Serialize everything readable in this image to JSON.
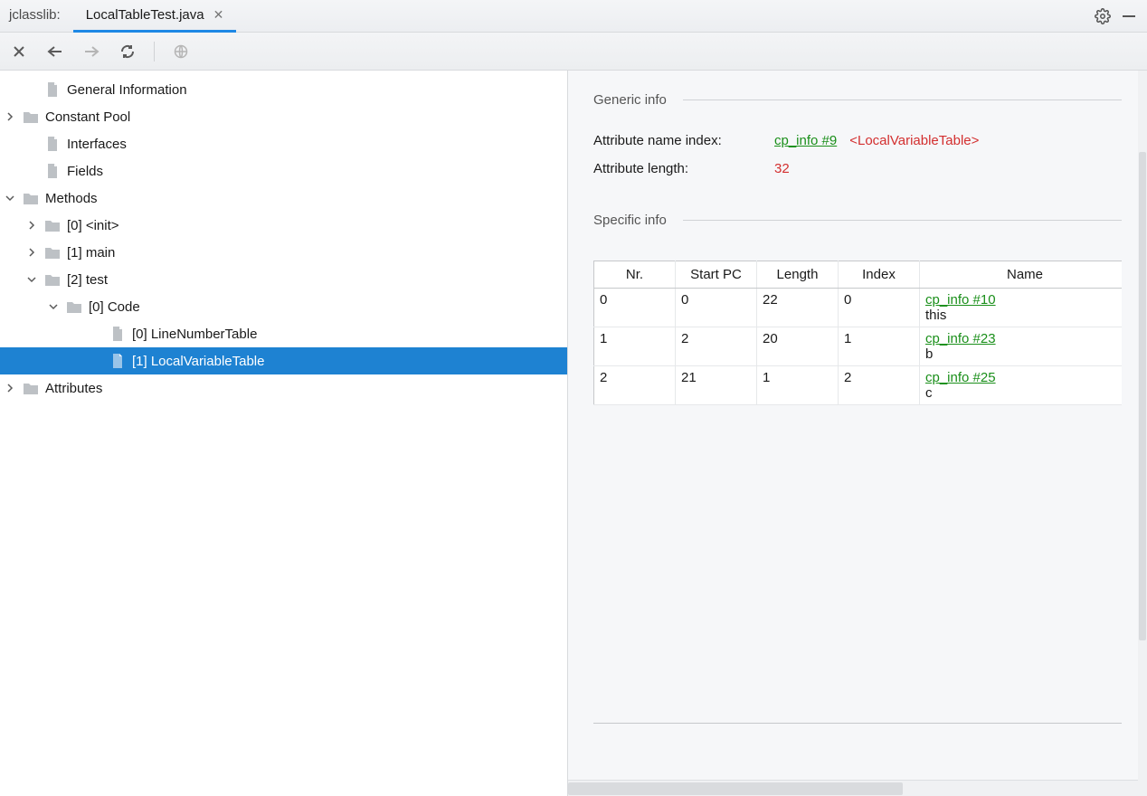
{
  "tabs": {
    "static_label": "jclasslib:",
    "active_label": "LocalTableTest.java"
  },
  "tree": {
    "items": [
      {
        "indent": 1,
        "expander": "",
        "icon": "file",
        "label": "General Information"
      },
      {
        "indent": 0,
        "expander": ">",
        "icon": "folder",
        "label": "Constant Pool"
      },
      {
        "indent": 1,
        "expander": "",
        "icon": "file",
        "label": "Interfaces"
      },
      {
        "indent": 1,
        "expander": "",
        "icon": "file",
        "label": "Fields"
      },
      {
        "indent": 0,
        "expander": "v",
        "icon": "folder",
        "label": "Methods"
      },
      {
        "indent": 1,
        "expander": ">",
        "icon": "folder",
        "label": "[0] <init>"
      },
      {
        "indent": 1,
        "expander": ">",
        "icon": "folder",
        "label": "[1] main"
      },
      {
        "indent": 1,
        "expander": "v",
        "icon": "folder",
        "label": "[2] test"
      },
      {
        "indent": 2,
        "expander": "v",
        "icon": "folder",
        "label": "[0] Code"
      },
      {
        "indent": 4,
        "expander": "",
        "icon": "file",
        "label": "[0] LineNumberTable"
      },
      {
        "indent": 4,
        "expander": "",
        "icon": "file",
        "label": "[1] LocalVariableTable",
        "selected": true
      },
      {
        "indent": 0,
        "expander": ">",
        "icon": "folder",
        "label": "Attributes"
      }
    ]
  },
  "detail": {
    "section1": "Generic info",
    "section2": "Specific info",
    "attr_name_label": "Attribute name index:",
    "attr_name_link": "cp_info #9",
    "attr_name_desc": "<LocalVariableTable>",
    "attr_len_label": "Attribute length:",
    "attr_len_value": "32",
    "table": {
      "headers": [
        "Nr.",
        "Start PC",
        "Length",
        "Index",
        "Name"
      ],
      "rows": [
        {
          "nr": "0",
          "startpc": "0",
          "length": "22",
          "index": "0",
          "link": "cp_info #10",
          "var": "this"
        },
        {
          "nr": "1",
          "startpc": "2",
          "length": "20",
          "index": "1",
          "link": "cp_info #23",
          "var": "b"
        },
        {
          "nr": "2",
          "startpc": "21",
          "length": "1",
          "index": "2",
          "link": "cp_info #25",
          "var": "c"
        }
      ]
    }
  }
}
